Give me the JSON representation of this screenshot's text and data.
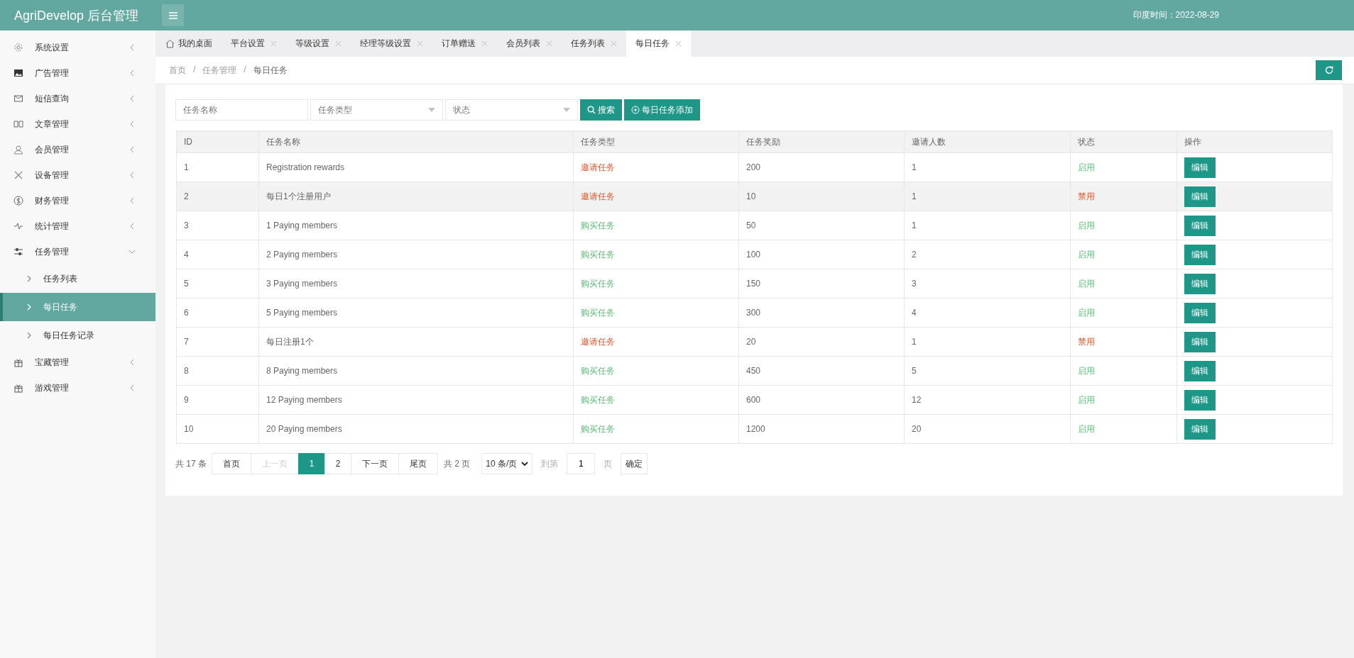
{
  "header": {
    "title": "AgriDevelop 后台管理",
    "time": "印度时间：2022-08-29"
  },
  "sidebar": {
    "items": [
      {
        "label": "系统设置",
        "expanded": false
      },
      {
        "label": "广告管理",
        "expanded": false
      },
      {
        "label": "短信查询",
        "expanded": false
      },
      {
        "label": "文章管理",
        "expanded": false
      },
      {
        "label": "会员管理",
        "expanded": false
      },
      {
        "label": "设备管理",
        "expanded": false
      },
      {
        "label": "财务管理",
        "expanded": false
      },
      {
        "label": "统计管理",
        "expanded": false
      },
      {
        "label": "任务管理",
        "expanded": true,
        "children": [
          {
            "label": "任务列表",
            "selected": false
          },
          {
            "label": "每日任务",
            "selected": true
          },
          {
            "label": "每日任务记录",
            "selected": false
          }
        ]
      },
      {
        "label": "宝藏管理",
        "expanded": false
      },
      {
        "label": "游戏管理",
        "expanded": false
      }
    ]
  },
  "tabs": [
    {
      "label": "我的桌面",
      "kind": "home",
      "selected": false
    },
    {
      "label": "平台设置",
      "kind": "closable",
      "selected": false
    },
    {
      "label": "等级设置",
      "kind": "closable",
      "selected": false
    },
    {
      "label": "经理等级设置",
      "kind": "closable",
      "selected": false
    },
    {
      "label": "订单赠送",
      "kind": "closable",
      "selected": false
    },
    {
      "label": "会员列表",
      "kind": "closable",
      "selected": false
    },
    {
      "label": "任务列表",
      "kind": "closable",
      "selected": false
    },
    {
      "label": "每日任务",
      "kind": "closable",
      "selected": true
    }
  ],
  "breadcrumb": {
    "separator": "/",
    "items": [
      "首页",
      "任务管理",
      "每日任务"
    ]
  },
  "filters": {
    "name": {
      "placeholder": "任务名称"
    },
    "type": {
      "placeholder": "任务类型"
    },
    "status": {
      "placeholder": "状态"
    },
    "search_button": "搜索",
    "add_button": "每日任务添加"
  },
  "table": {
    "columns": [
      "ID",
      "任务名称",
      "任务类型",
      "任务奖励",
      "邀请人数",
      "状态",
      "操作"
    ],
    "rows": [
      {
        "id": "1",
        "name": "Registration rewards",
        "type": "邀请任务",
        "kind": "invite",
        "reward": "200",
        "invites": "1",
        "status": "启用",
        "enabled": true,
        "hovered": false,
        "action": "编辑"
      },
      {
        "id": "2",
        "name": "每日1个注册用户",
        "type": "邀请任务",
        "kind": "invite",
        "reward": "10",
        "invites": "1",
        "status": "禁用",
        "enabled": false,
        "hovered": true,
        "action": "编辑"
      },
      {
        "id": "3",
        "name": "1 Paying members",
        "type": "购买任务",
        "kind": "purchase",
        "reward": "50",
        "invites": "1",
        "status": "启用",
        "enabled": true,
        "hovered": false,
        "action": "编辑"
      },
      {
        "id": "4",
        "name": "2 Paying members",
        "type": "购买任务",
        "kind": "purchase",
        "reward": "100",
        "invites": "2",
        "status": "启用",
        "enabled": true,
        "hovered": false,
        "action": "编辑"
      },
      {
        "id": "5",
        "name": "3 Paying members",
        "type": "购买任务",
        "kind": "purchase",
        "reward": "150",
        "invites": "3",
        "status": "启用",
        "enabled": true,
        "hovered": false,
        "action": "编辑"
      },
      {
        "id": "6",
        "name": "5 Paying members",
        "type": "购买任务",
        "kind": "purchase",
        "reward": "300",
        "invites": "4",
        "status": "启用",
        "enabled": true,
        "hovered": false,
        "action": "编辑"
      },
      {
        "id": "7",
        "name": "每日注册1个",
        "type": "邀请任务",
        "kind": "invite",
        "reward": "20",
        "invites": "1",
        "status": "禁用",
        "enabled": false,
        "hovered": false,
        "action": "编辑"
      },
      {
        "id": "8",
        "name": "8 Paying members",
        "type": "购买任务",
        "kind": "purchase",
        "reward": "450",
        "invites": "5",
        "status": "启用",
        "enabled": true,
        "hovered": false,
        "action": "编辑"
      },
      {
        "id": "9",
        "name": "12 Paying members",
        "type": "购买任务",
        "kind": "purchase",
        "reward": "600",
        "invites": "12",
        "status": "启用",
        "enabled": true,
        "hovered": false,
        "action": "编辑"
      },
      {
        "id": "10",
        "name": "20 Paying members",
        "type": "购买任务",
        "kind": "purchase",
        "reward": "1200",
        "invites": "20",
        "status": "启用",
        "enabled": true,
        "hovered": false,
        "action": "编辑"
      }
    ]
  },
  "pagination": {
    "total": "共 17 条",
    "first": "首页",
    "prev": "上一页",
    "pages": [
      {
        "label": "1",
        "selected": true
      },
      {
        "label": "2",
        "selected": false
      }
    ],
    "next": "下一页",
    "last": "尾页",
    "page_count": "共 2 页",
    "page_size": "10 条/页",
    "goto_label": "到第",
    "goto_value": "1",
    "page_unit": "页",
    "confirm": "确定"
  }
}
